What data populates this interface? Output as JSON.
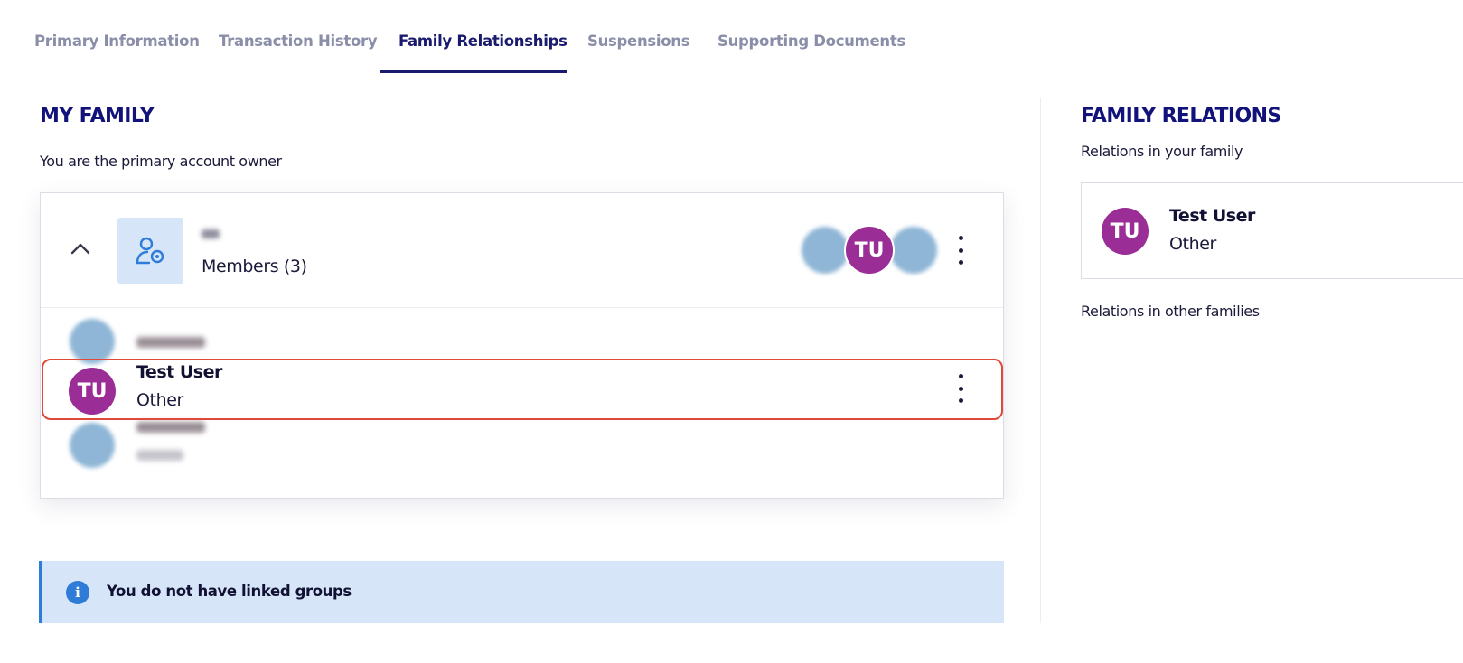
{
  "tabs": [
    {
      "label": "Primary Information",
      "active": false
    },
    {
      "label": "Transaction History",
      "active": false
    },
    {
      "label": "Family Relationships",
      "active": true
    },
    {
      "label": "Suspensions",
      "active": false
    },
    {
      "label": "Supporting Documents",
      "active": false
    }
  ],
  "my_family": {
    "heading": "MY FAMILY",
    "subtitle": "You are the primary account owner",
    "group": {
      "members_label": "Members (3)",
      "icon": "group-user-icon",
      "avatar_stack": [
        {
          "initials": "",
          "blurred": true
        },
        {
          "initials": "TU",
          "blurred": false
        },
        {
          "initials": "",
          "blurred": true
        }
      ]
    },
    "members": [
      {
        "name": "",
        "role": "",
        "blurred": true
      },
      {
        "name": "Test User",
        "role": "Other",
        "initials": "TU",
        "blurred": false,
        "highlighted": true
      },
      {
        "name": "",
        "role": "",
        "blurred": true
      }
    ],
    "banner": {
      "text": "You do not have linked groups",
      "icon": "info-icon"
    }
  },
  "family_relations": {
    "heading": "FAMILY RELATIONS",
    "in_your_family_label": "Relations in your family",
    "in_your_family": [
      {
        "name": "Test User",
        "role": "Other",
        "initials": "TU"
      }
    ],
    "in_other_families_label": "Relations in other families"
  },
  "colors": {
    "navy": "#12137a",
    "avatar_purple": "#9b2d96",
    "highlight_red": "#e0493a",
    "banner_bg": "#d6e6f8",
    "accent_blue": "#2e7bd8"
  }
}
